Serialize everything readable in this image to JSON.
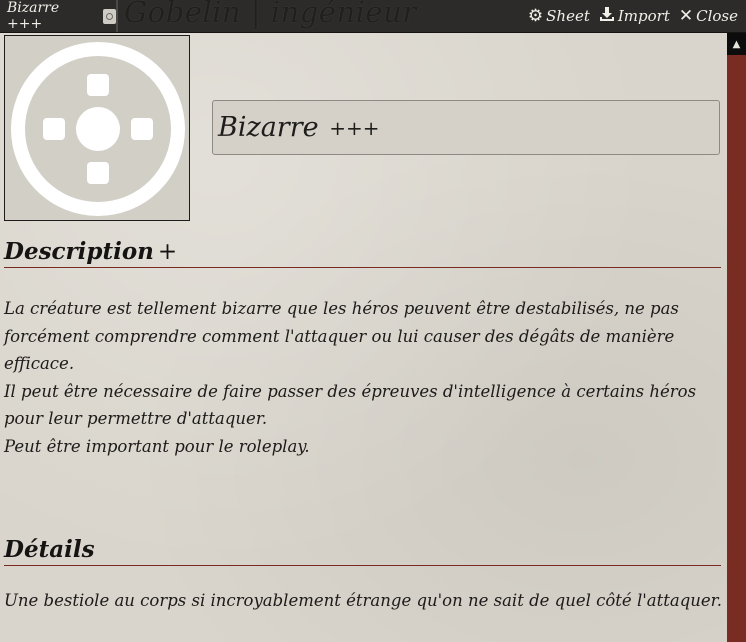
{
  "titlebar": {
    "tab_label": "Bizarre +++",
    "window_title": "Gobelin | ingénieur",
    "actions": {
      "sheet": "Sheet",
      "import": "Import",
      "close": "Close"
    }
  },
  "entry": {
    "name": "Bizarre",
    "name_suffix": "+++"
  },
  "description": {
    "heading": "Description",
    "heading_suffix": "+",
    "text": "La créature est tellement bizarre que les héros peuvent être destabilisés, ne pas forcément comprendre comment l'attaquer ou lui causer des dégâts de manière efficace.\nIl peut être nécessaire de faire passer des épreuves d'intelligence à certains héros pour leur permettre d'attaquer.\nPeut être important pour le roleplay."
  },
  "details": {
    "heading": "Détails",
    "text": "Une bestiole au corps si incroyablement étrange qu'on ne sait de quel côté l'attaquer."
  },
  "icons": {
    "tab": "sheet-icon",
    "sheet": "gear-icon",
    "import": "download-icon",
    "close": "close-icon",
    "portrait": "placeholder-token-icon",
    "scroll_up": "triangle-up-icon"
  },
  "colors": {
    "titlebar": "#2c2b29",
    "parchment": "#d9d5cc",
    "accent": "#792c21"
  }
}
